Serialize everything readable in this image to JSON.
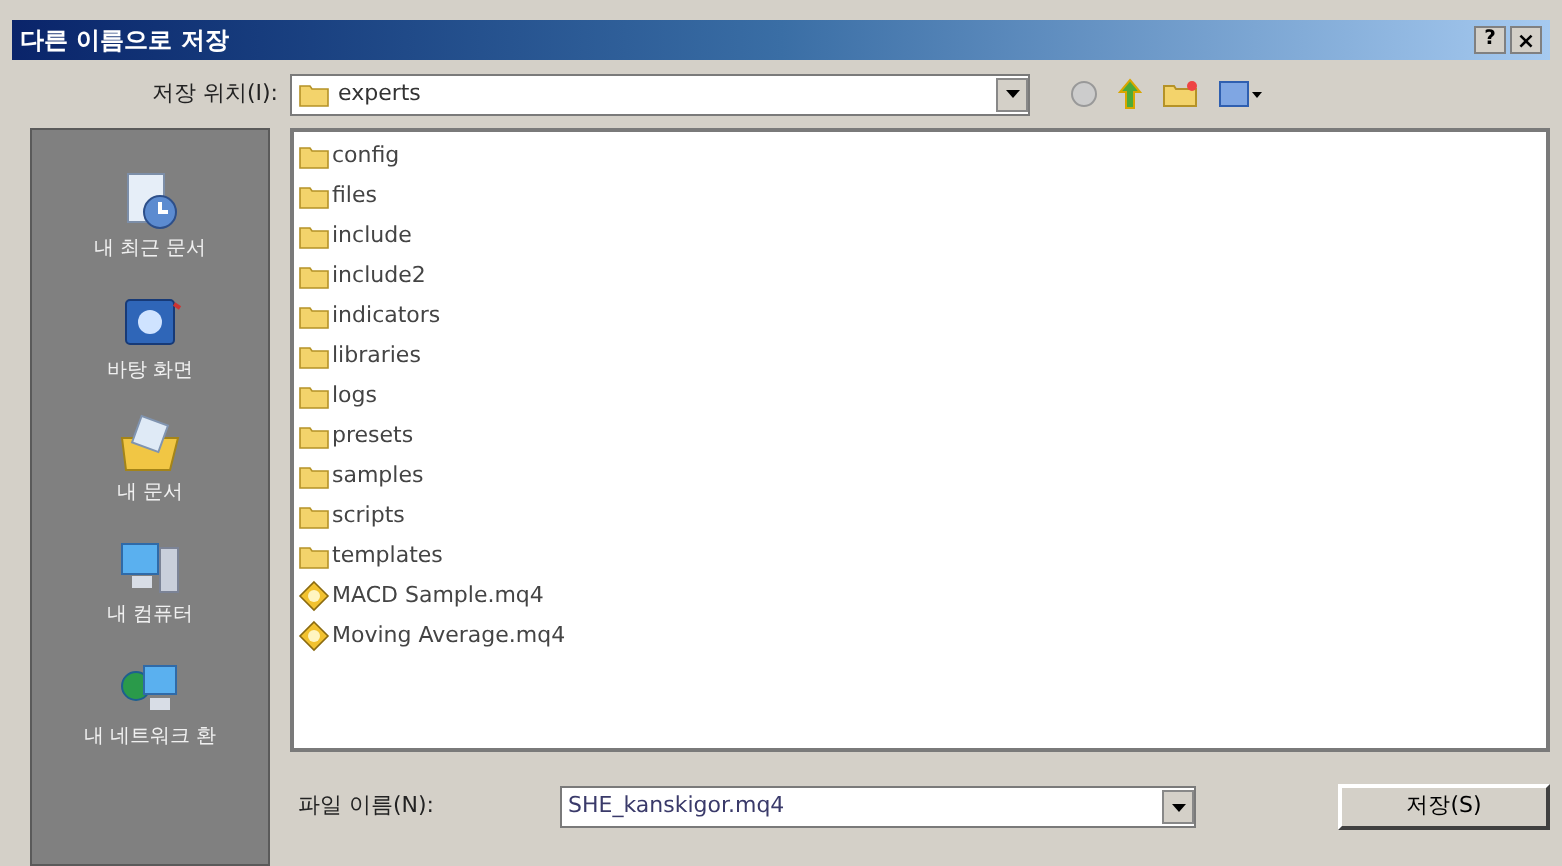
{
  "window": {
    "title": "다른 이름으로 저장",
    "help_button": "?",
    "close_button": "×"
  },
  "location": {
    "label": "저장 위치(I):",
    "value": "experts"
  },
  "places": [
    {
      "label": "내 최근 문서",
      "kind": "recent"
    },
    {
      "label": "바탕 화면",
      "kind": "desktop"
    },
    {
      "label": "내 문서",
      "kind": "documents"
    },
    {
      "label": "내 컴퓨터",
      "kind": "computer"
    },
    {
      "label": "내 네트워크 환",
      "kind": "network"
    }
  ],
  "files": [
    {
      "name": "config",
      "kind": "folder"
    },
    {
      "name": "files",
      "kind": "folder"
    },
    {
      "name": "include",
      "kind": "folder"
    },
    {
      "name": "include2",
      "kind": "folder"
    },
    {
      "name": "indicators",
      "kind": "folder"
    },
    {
      "name": "libraries",
      "kind": "folder"
    },
    {
      "name": "logs",
      "kind": "folder"
    },
    {
      "name": "presets",
      "kind": "folder"
    },
    {
      "name": "samples",
      "kind": "folder"
    },
    {
      "name": "scripts",
      "kind": "folder"
    },
    {
      "name": "templates",
      "kind": "folder"
    },
    {
      "name": "MACD Sample.mq4",
      "kind": "script"
    },
    {
      "name": "Moving Average.mq4",
      "kind": "script"
    }
  ],
  "file_name": {
    "label": "파일 이름(N):",
    "value": "SHE_kanskigor.mq4"
  },
  "save_button": "저장(S)"
}
